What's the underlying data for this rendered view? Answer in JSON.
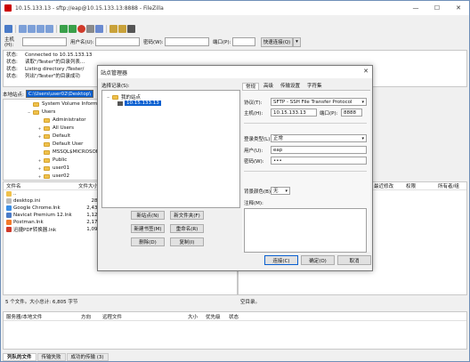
{
  "window": {
    "title": "10.15.133.13 - sftp://eap@10.15.133.13:8888 - FileZilla",
    "minimize_glyph": "—",
    "maximize_glyph": "☐",
    "close_glyph": "✕"
  },
  "quickconnect": {
    "host_label": "主机(H):",
    "user_label": "用户名(U):",
    "pass_label": "密码(W):",
    "port_label": "端口(P):",
    "connect_label": "快速连接(Q)",
    "dropdown_glyph": "▾"
  },
  "log": [
    {
      "label": "状态:",
      "text": "Connected to 10.15.133.13"
    },
    {
      "label": "状态:",
      "text": "读取\"/Tester\"的目录列表..."
    },
    {
      "label": "状态:",
      "text": "Listing directory /Tester/"
    },
    {
      "label": "状态:",
      "text": "列出\"/Tester\"的目录成功"
    }
  ],
  "local": {
    "path_label": "本地站点:",
    "path_value": "C:\\Users\\user02\\Desktop\\",
    "tree": [
      {
        "label": "System Volume Informat",
        "expander": ""
      },
      {
        "label": "Users",
        "expander": "−"
      },
      {
        "label": "Administrator",
        "expander": ""
      },
      {
        "label": "All Users",
        "expander": "+"
      },
      {
        "label": "Default",
        "expander": "+"
      },
      {
        "label": "Default User",
        "expander": ""
      },
      {
        "label": "MSSQL$MICROSOFT",
        "expander": ""
      },
      {
        "label": "Public",
        "expander": "+"
      },
      {
        "label": "user01",
        "expander": "+"
      },
      {
        "label": "user02",
        "expander": "+"
      }
    ],
    "columns": {
      "name": "文件名",
      "size": "文件大小"
    },
    "files": [
      {
        "name": "..",
        "size": ""
      },
      {
        "name": "desktop.ini",
        "size": "282"
      },
      {
        "name": "Google Chrome.lnk",
        "size": "2,438"
      },
      {
        "name": "Navicat Premium 12.lnk",
        "size": "1,120"
      },
      {
        "name": "Postman.lnk",
        "size": "2,172"
      },
      {
        "name": "迅捷PDF转换器.lnk",
        "size": "1,096"
      }
    ],
    "status": "5 个文件。大小总计: 6,805 字节"
  },
  "remote": {
    "columns": {
      "name": "文件名",
      "size": "文件大小",
      "type": "文件类型",
      "modified": "最近修改",
      "perms": "权限",
      "owner": "所有者/组"
    },
    "status": "空目录。"
  },
  "queue": {
    "columns": [
      "服务器/本地文件",
      "方向",
      "远程文件",
      "大小",
      "优先级",
      "状态"
    ]
  },
  "bottom_tabs": [
    "列队的文件",
    "传输失败",
    "成功的传输 (3)"
  ],
  "dialog": {
    "title": "站点管理器",
    "close_glyph": "✕",
    "select_label": "选择记录(S):",
    "tree_root": "我的站点",
    "tree_site": "10.15.133.13",
    "buttons": {
      "new_site": "新站点(N)",
      "new_folder": "新文件夹(F)",
      "new_bookmark": "新建书签(M)",
      "rename": "重命名(R)",
      "delete": "删除(D)",
      "copy": "复制(I)",
      "connect": "连接(C)",
      "ok": "确定(O)",
      "cancel": "取消"
    },
    "tabs": [
      "常规",
      "高级",
      "传输设置",
      "字符集"
    ],
    "general": {
      "protocol_label": "协议(T):",
      "protocol_value": "SFTP - SSH File Transfer Protocol",
      "host_label": "主机(H):",
      "host_value": "10.15.133.13",
      "port_label": "端口(P):",
      "port_value": "8888",
      "logon_label": "登录类型(L):",
      "logon_value": "正常",
      "user_label": "用户(U):",
      "user_value": "eap",
      "pass_label": "密码(W):",
      "pass_value": "•••",
      "bg_label": "背景颜色(B):",
      "bg_value": "无",
      "comment_label": "注释(M):",
      "dropdown_glyph": "▾"
    }
  }
}
